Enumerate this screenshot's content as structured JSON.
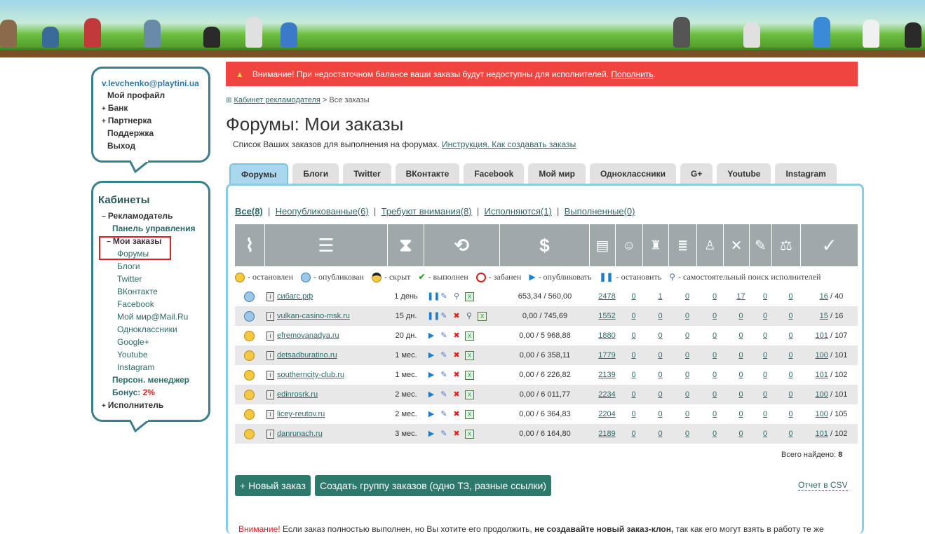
{
  "sidebar": {
    "email": "v.levchenko@playtini.ua",
    "links": [
      "Мой профайл",
      "Банк",
      "Партнерка",
      "Поддержка",
      "Выход"
    ],
    "cabinets_title": "Кабинеты",
    "advertiser": "Рекламодатель",
    "control_panel": "Панель управления",
    "my_orders": "Мои заказы",
    "sub_items": [
      "Форумы",
      "Блоги",
      "Twitter",
      "ВКонтакте",
      "Facebook",
      "Мой мир@Mail.Ru",
      "Одноклассники",
      "Google+",
      "Youtube",
      "Instagram"
    ],
    "personal_manager": "Персон. менеджер",
    "bonus_label": "Бонус:",
    "bonus_value": "2%",
    "executor": "Исполнитель",
    "highlight_color": "#e02020"
  },
  "alert": {
    "text": "Внимание! При недостаточном балансе ваши заказы будут недоступны для исполнителей.",
    "link": "Пополнить",
    "suffix": ".",
    "color": "#f0443f"
  },
  "breadcrumb": {
    "link": "Кабинет рекламодателя",
    "sep": ">",
    "current": "Все заказы"
  },
  "page": {
    "title": "Форумы: Мои заказы",
    "subtitle": "Список Ваших заказов для выполнения на форумах.",
    "instruction_link": "Инструкция. Как создавать заказы"
  },
  "tabs": [
    "Форумы",
    "Блоги",
    "Twitter",
    "ВКонтакте",
    "Facebook",
    "Мой мир",
    "Одноклассники",
    "G+",
    "Youtube",
    "Instagram"
  ],
  "filters": [
    {
      "label": "Все",
      "count": "(8)"
    },
    {
      "label": "Неопубликованные",
      "count": "(6)"
    },
    {
      "label": "Требуют внимания",
      "count": "(8)"
    },
    {
      "label": "Исполняются",
      "count": "(1)"
    },
    {
      "label": "Выполненные",
      "count": "(0)"
    }
  ],
  "header_icons": [
    "paperclip-icon",
    "list-icon",
    "hourglass-icon",
    "refresh-icon",
    "dollar-icon",
    "clipboard-icon",
    "group-icon",
    "stamp-icon",
    "stack-icon",
    "person-money-icon",
    "tools-icon",
    "pencil-icon",
    "scales-icon",
    "check-icon"
  ],
  "legend": [
    {
      "icon": "smile-icon",
      "text": "- остановлен"
    },
    {
      "icon": "clock-icon",
      "text": "- опубликован"
    },
    {
      "icon": "sunglasses-icon",
      "text": "- скрыт"
    },
    {
      "icon": "check-icon",
      "text": "- выполнен"
    },
    {
      "icon": "ban-icon",
      "text": "- забанен"
    },
    {
      "icon": "play-icon",
      "text": "- опубликовать"
    },
    {
      "icon": "pause-icon",
      "text": "- остановить"
    },
    {
      "icon": "search-icon",
      "text": "- самостоятельный поиск исполнителей"
    }
  ],
  "rows": [
    {
      "status": "clock",
      "name": "сибагс.рф",
      "period": "1 день",
      "actions": [
        "pause",
        "edit",
        "search",
        "xls"
      ],
      "money": "653,34 / 560,00",
      "c1": "2478",
      "c2": "0",
      "c3": "1",
      "c4": "0",
      "c5": "0",
      "c6": "17",
      "c7": "0",
      "c8": "0",
      "done": "16",
      "total": "/ 40"
    },
    {
      "status": "clock",
      "name": "vulkan-casino-msk.ru",
      "period": "15 дн.",
      "actions": [
        "pause",
        "edit",
        "del",
        "search",
        "xls"
      ],
      "money": "0,00 / 745,69",
      "c1": "1552",
      "c2": "0",
      "c3": "0",
      "c4": "0",
      "c5": "0",
      "c6": "0",
      "c7": "0",
      "c8": "0",
      "done": "15",
      "total": "/ 16"
    },
    {
      "status": "smile",
      "name": "efremovanadya.ru",
      "period": "20 дн.",
      "actions": [
        "play",
        "edit",
        "del",
        "xls"
      ],
      "money": "0,00 / 5 968,88",
      "c1": "1880",
      "c2": "0",
      "c3": "0",
      "c4": "0",
      "c5": "0",
      "c6": "0",
      "c7": "0",
      "c8": "0",
      "done": "101",
      "total": "/ 107"
    },
    {
      "status": "smile",
      "name": "detsadburatino.ru",
      "period": "1 мес.",
      "actions": [
        "play",
        "edit",
        "del",
        "xls"
      ],
      "money": "0,00 / 6 358,11",
      "c1": "1779",
      "c2": "0",
      "c3": "0",
      "c4": "0",
      "c5": "0",
      "c6": "0",
      "c7": "0",
      "c8": "0",
      "done": "100",
      "total": "/ 101"
    },
    {
      "status": "smile",
      "name": "southerncity-club.ru",
      "period": "1 мес.",
      "actions": [
        "play",
        "edit",
        "del",
        "xls"
      ],
      "money": "0,00 / 6 226,82",
      "c1": "2139",
      "c2": "0",
      "c3": "0",
      "c4": "0",
      "c5": "0",
      "c6": "0",
      "c7": "0",
      "c8": "0",
      "done": "101",
      "total": "/ 102"
    },
    {
      "status": "smile",
      "name": "edinrosrk.ru",
      "period": "2 мес.",
      "actions": [
        "play",
        "edit",
        "del",
        "xls"
      ],
      "money": "0,00 / 6 011,77",
      "c1": "2234",
      "c2": "0",
      "c3": "0",
      "c4": "0",
      "c5": "0",
      "c6": "0",
      "c7": "0",
      "c8": "0",
      "done": "100",
      "total": "/ 101"
    },
    {
      "status": "smile",
      "name": "licey-reutov.ru",
      "period": "2 мес.",
      "actions": [
        "play",
        "edit",
        "del",
        "xls"
      ],
      "money": "0,00 / 6 364,83",
      "c1": "2204",
      "c2": "0",
      "c3": "0",
      "c4": "0",
      "c5": "0",
      "c6": "0",
      "c7": "0",
      "c8": "0",
      "done": "100",
      "total": "/ 105"
    },
    {
      "status": "smile",
      "name": "danrunach.ru",
      "period": "3 мес.",
      "actions": [
        "play",
        "edit",
        "del",
        "xls"
      ],
      "money": "0,00 / 6 164,80",
      "c1": "2189",
      "c2": "0",
      "c3": "0",
      "c4": "0",
      "c5": "0",
      "c6": "0",
      "c7": "0",
      "c8": "0",
      "done": "101",
      "total": "/ 102"
    }
  ],
  "found_label": "Всего найдено:",
  "found_count": "8",
  "buttons": {
    "new_order": "+ Новый заказ",
    "group_order": "Создать группу заказов (одно ТЗ, разные ссылки)",
    "csv": "Отчет в CSV"
  },
  "warning": {
    "prefix": "Внимание!",
    "text": "Если заказ полностью выполнен, но Вы хотите его продолжить,",
    "bold": "не создавайте новый заказ-клон,",
    "tail": "так как его могут взять в работу те же"
  }
}
